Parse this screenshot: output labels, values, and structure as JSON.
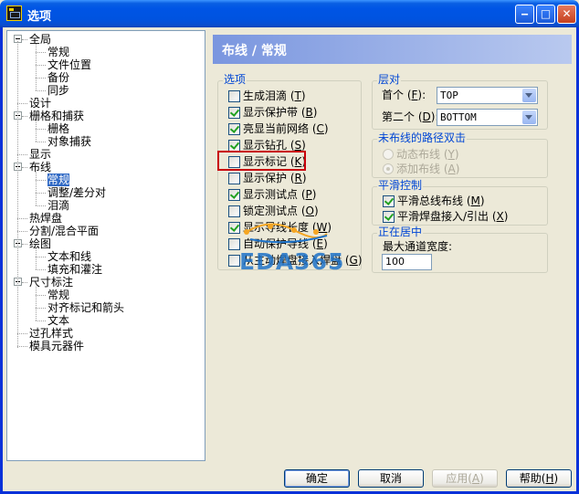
{
  "window": {
    "title": "选项",
    "app_icon_text": "PADS"
  },
  "tree": [
    {
      "label": "全局",
      "level": 0,
      "expander": true
    },
    {
      "label": "常规",
      "level": 2
    },
    {
      "label": "文件位置",
      "level": 2
    },
    {
      "label": "备份",
      "level": 2
    },
    {
      "label": "同步",
      "level": 2
    },
    {
      "label": "设计",
      "level": 0
    },
    {
      "label": "栅格和捕获",
      "level": 0,
      "expander": true
    },
    {
      "label": "栅格",
      "level": 2
    },
    {
      "label": "对象捕获",
      "level": 2
    },
    {
      "label": "显示",
      "level": 0
    },
    {
      "label": "布线",
      "level": 0,
      "expander": true
    },
    {
      "label": "常规",
      "level": 2,
      "selected": true
    },
    {
      "label": "调整/差分对",
      "level": 2
    },
    {
      "label": "泪滴",
      "level": 2
    },
    {
      "label": "热焊盘",
      "level": 0
    },
    {
      "label": "分割/混合平面",
      "level": 0
    },
    {
      "label": "绘图",
      "level": 0,
      "expander": true
    },
    {
      "label": "文本和线",
      "level": 2
    },
    {
      "label": "填充和灌注",
      "level": 2
    },
    {
      "label": "尺寸标注",
      "level": 0,
      "expander": true
    },
    {
      "label": "常规",
      "level": 2
    },
    {
      "label": "对齐标记和箭头",
      "level": 2
    },
    {
      "label": "文本",
      "level": 2
    },
    {
      "label": "过孔样式",
      "level": 0
    },
    {
      "label": "模具元器件",
      "level": 0
    }
  ],
  "panel": {
    "title": "布线 / 常规"
  },
  "options": {
    "label": "选项",
    "items": [
      {
        "label": "生成泪滴",
        "key": "T",
        "checked": false
      },
      {
        "label": "显示保护带",
        "key": "B",
        "checked": true
      },
      {
        "label": "亮显当前网络",
        "key": "C",
        "checked": true
      },
      {
        "label": "显示钻孔",
        "key": "S",
        "checked": true
      },
      {
        "label": "显示标记",
        "key": "K",
        "checked": false
      },
      {
        "label": "显示保护",
        "key": "R",
        "checked": false
      },
      {
        "label": "显示测试点",
        "key": "P",
        "checked": true
      },
      {
        "label": "锁定测试点",
        "key": "O",
        "checked": false
      },
      {
        "label": "显示导线长度",
        "key": "W",
        "checked": true
      },
      {
        "label": "自动保护导线",
        "key": "E",
        "checked": false
      },
      {
        "label": "从主动焊盘接入焊盘",
        "key": "G",
        "checked": false
      }
    ]
  },
  "layer_pair": {
    "label": "层对",
    "first_label": "首个",
    "first_key": "F",
    "first_value": "TOP",
    "second_label": "第二个",
    "second_key": "D",
    "second_value": "BOTTOM"
  },
  "unrouted_dblclick": {
    "label": "未布线的路径双击",
    "options": [
      {
        "label": "动态布线",
        "key": "Y",
        "selected": false
      },
      {
        "label": "添加布线",
        "key": "A",
        "selected": true
      }
    ]
  },
  "smoothing": {
    "label": "平滑控制",
    "items": [
      {
        "label": "平滑总线布线",
        "key": "M",
        "checked": true
      },
      {
        "label": "平滑焊盘接入/引出",
        "key": "X",
        "checked": true
      }
    ]
  },
  "centering": {
    "label": "正在居中",
    "max_via_width_label": "最大通道宽度:",
    "max_via_width_value": "100"
  },
  "buttons": {
    "ok": "确定",
    "cancel": "取消",
    "apply": "应用",
    "apply_key": "A",
    "help": "帮助",
    "help_key": "H"
  },
  "watermark": "EDA365",
  "colors": {
    "titlebar": "#0055e5",
    "group_label": "#0046d5",
    "highlight": "#c8000a",
    "selection": "#316ac5"
  }
}
